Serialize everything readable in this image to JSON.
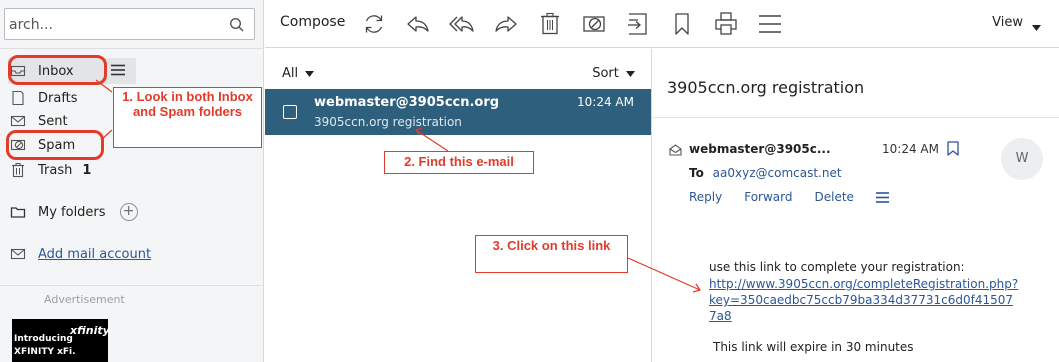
{
  "search": {
    "text": "arch..."
  },
  "folders": [
    {
      "label": "Inbox"
    },
    {
      "label": "Drafts"
    },
    {
      "label": "Sent"
    },
    {
      "label": "Spam"
    },
    {
      "label": "Trash",
      "count": "1"
    }
  ],
  "sidebar": {
    "my_folders": "My folders",
    "add_mail_account": "Add mail account",
    "advertisement": "Advertisement",
    "ad_introducing": "Introducing",
    "ad_brand": "XFINITY xFi.",
    "ad_logo": "xfinity"
  },
  "toolbar": {
    "compose": "Compose",
    "view": "View"
  },
  "list": {
    "filter": "All",
    "sort": "Sort",
    "message": {
      "sender": "webmaster@3905ccn.org",
      "time": "10:24 AM",
      "subject": "3905ccn.org registration"
    }
  },
  "reader": {
    "subject": "3905ccn.org registration",
    "sender": "webmaster@3905c...",
    "time": "10:24 AM",
    "avatar_letter": "W",
    "to_label": "To",
    "to_address": "aa0xyz@comcast.net",
    "actions": {
      "reply": "Reply",
      "forward": "Forward",
      "delete": "Delete"
    },
    "body_intro": "use this link to complete your registration:",
    "link": "http://www.3905ccn.org/completeRegistration.php?key=350caedbc75ccb79ba334d37731c6d0f415077a8",
    "expire": "This link will expire in 30 minutes"
  },
  "annotations": {
    "step1": "1. Look in both Inbox and Spam folders",
    "step2": "2. Find this e-mail",
    "step3": "3. Click on this link",
    "color": "#e23b2b"
  },
  "colors": {
    "selected_row": "#2e5f7d",
    "link": "#2b5797"
  }
}
